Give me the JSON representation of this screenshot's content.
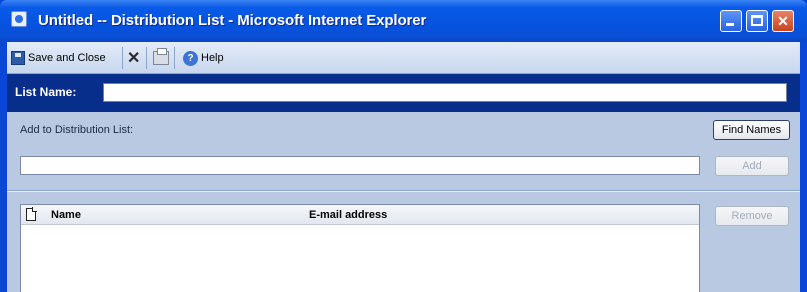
{
  "window": {
    "title": "Untitled -- Distribution List - Microsoft Internet Explorer"
  },
  "toolbar": {
    "save_close_label": "Save and Close",
    "help_label": "Help"
  },
  "form": {
    "list_name_label": "List Name:",
    "list_name_value": "",
    "add_to_label": "Add to Distribution List:",
    "add_input_value": "",
    "find_names_label": "Find Names",
    "add_label": "Add",
    "remove_label": "Remove"
  },
  "members_table": {
    "columns": [
      "Name",
      "E-mail address"
    ],
    "rows": []
  },
  "colors": {
    "title_bar": "#0553e0",
    "header_bar": "#082e8c",
    "client_background": "#b9c9e2"
  },
  "icons": [
    "ie-window-icon",
    "minimize-icon",
    "maximize-icon",
    "close-icon",
    "save-icon",
    "delete-icon",
    "print-icon",
    "help-icon",
    "document-icon"
  ]
}
